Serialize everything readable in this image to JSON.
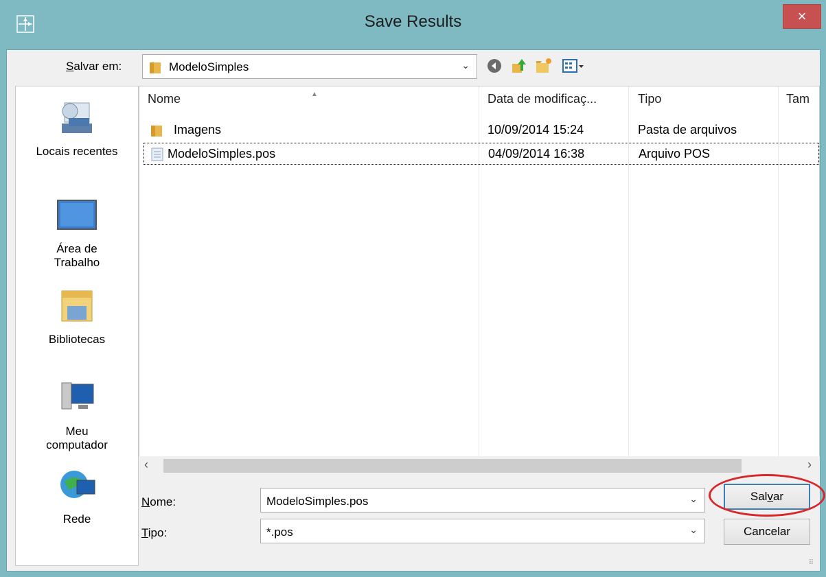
{
  "window": {
    "title": "Save Results",
    "close_label": "×"
  },
  "toolbar": {
    "save_in_label_prefix": "S",
    "save_in_label_rest": "alvar em:",
    "save_in_value": "ModeloSimples",
    "icons": [
      "back-icon",
      "up-folder-icon",
      "new-folder-icon",
      "view-menu-icon"
    ]
  },
  "places": [
    {
      "label": "Locais recentes",
      "icon": "recent-places-icon"
    },
    {
      "label": "Área de Trabalho",
      "icon": "desktop-icon"
    },
    {
      "label": "Bibliotecas",
      "icon": "libraries-icon"
    },
    {
      "label": "Meu computador",
      "icon": "computer-icon"
    },
    {
      "label": "Rede",
      "icon": "network-icon"
    }
  ],
  "filelist": {
    "columns": [
      "Nome",
      "Data de modificaç...",
      "Tipo",
      "Tam"
    ],
    "rows": [
      {
        "name": "Imagens",
        "date": "10/09/2014 15:24",
        "type": "Pasta de arquivos",
        "icon": "folder-icon"
      },
      {
        "name": "ModeloSimples.pos",
        "date": "04/09/2014 16:38",
        "type": "Arquivo POS",
        "icon": "file-icon",
        "selected": true
      }
    ]
  },
  "form": {
    "name_label_prefix": "N",
    "name_label_rest": "ome:",
    "name_value": "ModeloSimples.pos",
    "type_label_prefix": "T",
    "type_label_rest": "ipo:",
    "type_value": "*.pos",
    "save_button_prefix": "Sal",
    "save_button_accel": "v",
    "save_button_rest": "ar",
    "cancel_button": "Cancelar"
  },
  "colors": {
    "frame": "#7fbac3",
    "close": "#c75050",
    "highlight": "#d9262a"
  }
}
